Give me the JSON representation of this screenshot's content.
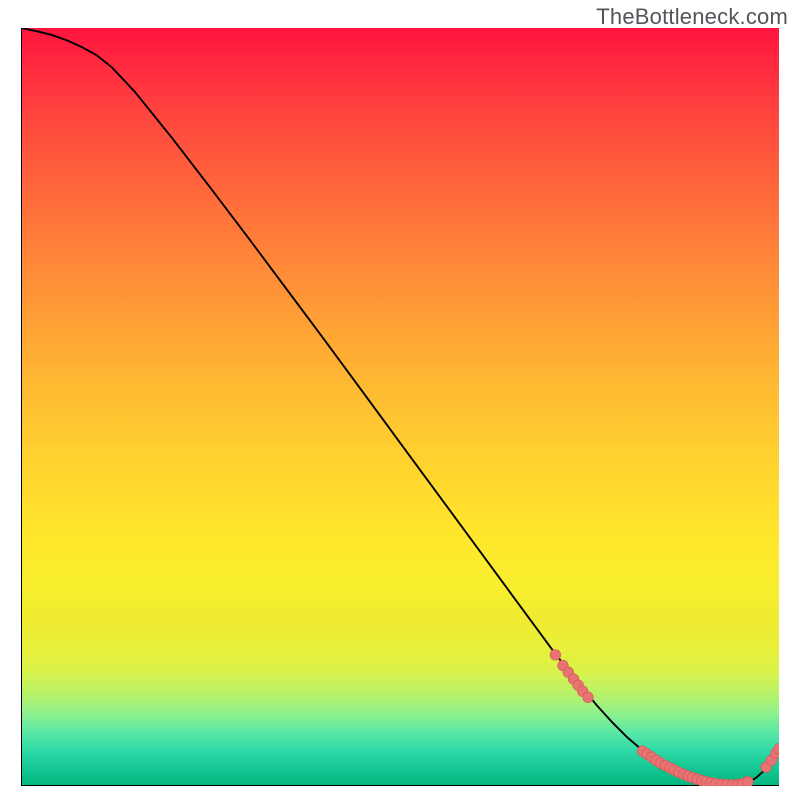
{
  "watermark": "TheBottleneck.com",
  "colors": {
    "curve": "#000000",
    "marker_fill": "#e77373",
    "marker_stroke": "#d85a5a",
    "gradient_top": "#ff153f",
    "gradient_bottom": "#04b87f"
  },
  "chart_data": {
    "type": "line",
    "title": "",
    "xlabel": "",
    "ylabel": "",
    "xlim": [
      0,
      100
    ],
    "ylim": [
      0,
      100
    ],
    "x": [
      0,
      2,
      4,
      6,
      8,
      10,
      12,
      15,
      20,
      25,
      30,
      35,
      40,
      45,
      50,
      55,
      60,
      65,
      70,
      72,
      74,
      76,
      78,
      80,
      82,
      84,
      86,
      88,
      90,
      92,
      94,
      96,
      97,
      98,
      99,
      100
    ],
    "y": [
      100,
      99.6,
      99.1,
      98.4,
      97.5,
      96.4,
      94.8,
      91.6,
      85.4,
      78.9,
      72.3,
      65.6,
      58.9,
      52.1,
      45.3,
      38.5,
      31.7,
      24.9,
      18.1,
      15.5,
      13.0,
      10.6,
      8.4,
      6.4,
      4.7,
      3.2,
      2.0,
      1.1,
      0.5,
      0.15,
      0.05,
      0.5,
      1.1,
      2.0,
      3.3,
      4.9
    ],
    "marker_clusters": [
      {
        "name": "upper-slope-cluster",
        "points": [
          [
            70.5,
            17.3
          ],
          [
            71.5,
            15.9
          ],
          [
            72.2,
            15.0
          ],
          [
            72.9,
            14.1
          ],
          [
            73.5,
            13.3
          ],
          [
            74.1,
            12.5
          ],
          [
            74.8,
            11.7
          ]
        ]
      },
      {
        "name": "valley-cluster",
        "points": [
          [
            82.0,
            4.6
          ],
          [
            82.6,
            4.2
          ],
          [
            83.2,
            3.8
          ],
          [
            83.8,
            3.4
          ],
          [
            84.4,
            3.0
          ],
          [
            85.0,
            2.7
          ],
          [
            85.6,
            2.4
          ],
          [
            86.2,
            2.1
          ],
          [
            86.8,
            1.8
          ],
          [
            87.4,
            1.55
          ],
          [
            88.0,
            1.3
          ],
          [
            88.6,
            1.1
          ],
          [
            89.2,
            0.9
          ],
          [
            89.8,
            0.72
          ],
          [
            90.4,
            0.56
          ],
          [
            91.0,
            0.42
          ],
          [
            91.7,
            0.3
          ],
          [
            92.4,
            0.22
          ],
          [
            93.1,
            0.16
          ],
          [
            93.8,
            0.14
          ],
          [
            94.5,
            0.18
          ],
          [
            95.2,
            0.32
          ],
          [
            95.9,
            0.55
          ]
        ]
      },
      {
        "name": "upturn-cluster",
        "points": [
          [
            98.3,
            2.5
          ],
          [
            99.0,
            3.4
          ],
          [
            99.6,
            4.3
          ],
          [
            100.0,
            4.9
          ]
        ]
      }
    ]
  }
}
